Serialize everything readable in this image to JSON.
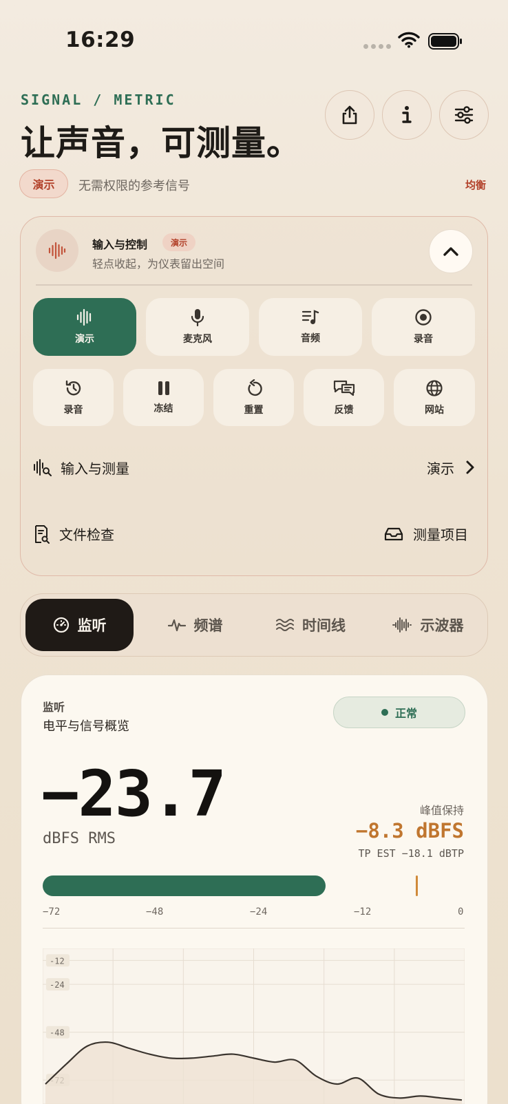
{
  "status_bar": {
    "time": "16:29"
  },
  "header": {
    "kicker": "SIGNAL / METRIC",
    "headline": "让声音，可测量。",
    "demo_pill": "演示",
    "subtitle": "无需权限的参考信号",
    "right_tag": "均衡",
    "buttons": [
      "share-icon",
      "info-icon",
      "sliders-icon"
    ]
  },
  "control": {
    "title": "输入与控制",
    "tag": "演示",
    "subtitle": "轻点收起，为仪表留出空间",
    "tiles_row1": [
      {
        "label": "演示",
        "icon": "waveform-icon",
        "active": true
      },
      {
        "label": "麦克风",
        "icon": "mic-icon",
        "active": false
      },
      {
        "label": "音频",
        "icon": "music-list-icon",
        "active": false
      },
      {
        "label": "录音",
        "icon": "record-icon",
        "active": false
      }
    ],
    "tiles_row2": [
      {
        "label": "录音",
        "icon": "history-icon"
      },
      {
        "label": "冻结",
        "icon": "pause-icon"
      },
      {
        "label": "重置",
        "icon": "reset-icon"
      },
      {
        "label": "反馈",
        "icon": "feedback-icon"
      },
      {
        "label": "网站",
        "icon": "globe-icon"
      }
    ],
    "input_row": {
      "label": "输入与测量",
      "value": "演示"
    },
    "file_check": "文件检查",
    "measure_items": "测量项目"
  },
  "tabs": [
    {
      "label": "监听",
      "icon": "gauge-icon",
      "active": true
    },
    {
      "label": "频谱",
      "icon": "pulse-icon",
      "active": false
    },
    {
      "label": "时间线",
      "icon": "waves-icon",
      "active": false
    },
    {
      "label": "示波器",
      "icon": "oscilloscope-icon",
      "active": false
    }
  ],
  "monitor": {
    "section_label": "监听",
    "title": "电平与信号概览",
    "status": "正常",
    "value": "−23.7",
    "unit": "dBFS RMS",
    "peak_label": "峰值保持",
    "peak_value": "−8.3 dBFS",
    "tp_est": "TP EST −18.1 dBTP",
    "meter": {
      "min": -72,
      "max": 0,
      "rms": -23.7,
      "peak": -8.3,
      "ticks": [
        "−72",
        "−48",
        "−24",
        "−12",
        "0"
      ]
    },
    "colors": {
      "accent": "#2e6e55",
      "peak": "#c0762f"
    }
  },
  "chart_data": {
    "type": "area",
    "y_ticks": [
      "-12",
      "-24",
      "-48",
      "-72"
    ],
    "ylim": [
      -84,
      -6
    ],
    "grid": true,
    "x": [
      0,
      5,
      10,
      15,
      20,
      25,
      30,
      35,
      40,
      45,
      50,
      55,
      60,
      65,
      70,
      75,
      80,
      85,
      90,
      95,
      100
    ],
    "values": [
      -74,
      -64,
      -55,
      -53,
      -56,
      -59,
      -61,
      -61,
      -60,
      -59,
      -61,
      -63,
      -62,
      -70,
      -74,
      -71,
      -79,
      -81,
      -80,
      -81,
      -82
    ]
  }
}
